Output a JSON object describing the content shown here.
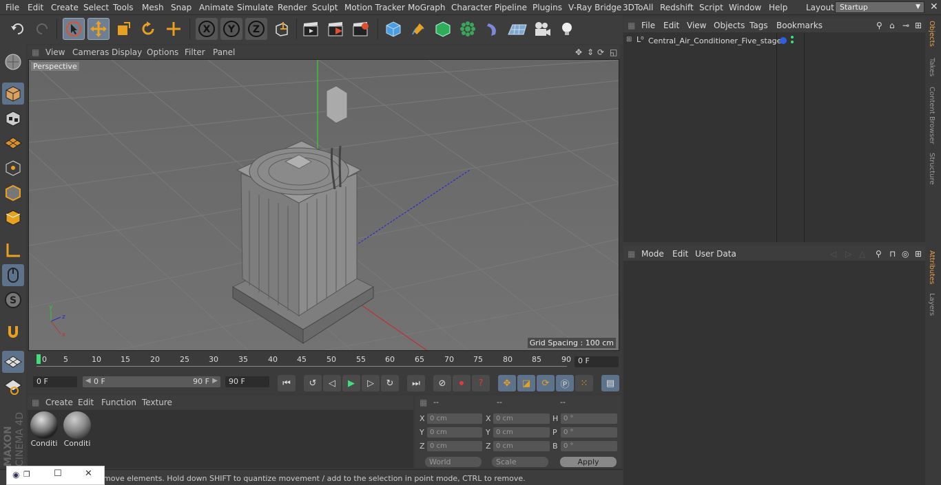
{
  "menubar": {
    "items": [
      "File",
      "Edit",
      "Create",
      "Select",
      "Tools",
      "Mesh",
      "Snap",
      "Animate",
      "Simulate",
      "Render",
      "Sculpt",
      "Motion Tracker",
      "MoGraph",
      "Character",
      "Pipeline",
      "Plugins",
      "V-Ray Bridge",
      "3DToAll",
      "Redshift",
      "Script",
      "Window",
      "Help"
    ],
    "layout_label": "Layout:",
    "layout_value": "Startup"
  },
  "viewport": {
    "menu": [
      "View",
      "Cameras",
      "Display",
      "Options",
      "Filter",
      "Panel"
    ],
    "label": "Perspective",
    "grid_spacing": "Grid Spacing : 100 cm"
  },
  "timeline": {
    "ticks": [
      "0",
      "5",
      "10",
      "15",
      "20",
      "25",
      "30",
      "35",
      "40",
      "45",
      "50",
      "55",
      "60",
      "65",
      "70",
      "75",
      "80",
      "85",
      "90"
    ],
    "current_frame": "0 F"
  },
  "transport": {
    "start": "0 F",
    "range_start": "0 F",
    "range_end": "90 F",
    "end": "90 F"
  },
  "materials": {
    "menu": [
      "Create",
      "Edit",
      "Function",
      "Texture"
    ],
    "items": [
      "Conditi",
      "Conditi"
    ]
  },
  "coords": {
    "headers": [
      "--",
      "--",
      "--"
    ],
    "rows": [
      {
        "a": "X",
        "av": "0 cm",
        "b": "X",
        "bv": "0 cm",
        "c": "H",
        "cv": "0 °"
      },
      {
        "a": "Y",
        "av": "0 cm",
        "b": "Y",
        "bv": "0 cm",
        "c": "P",
        "cv": "0 °"
      },
      {
        "a": "Z",
        "av": "0 cm",
        "b": "Z",
        "bv": "0 cm",
        "c": "B",
        "cv": "0 °"
      }
    ],
    "mode": "World",
    "scale": "Scale",
    "apply": "Apply"
  },
  "objects": {
    "menu": [
      "File",
      "Edit",
      "View",
      "Objects",
      "Tags",
      "Bookmarks"
    ],
    "item": "Central_Air_Conditioner_Five_stage"
  },
  "attributes": {
    "menu": [
      "Mode",
      "Edit",
      "User Data"
    ]
  },
  "sidetabs": [
    "Objects",
    "Takes",
    "Content Browser",
    "Structure",
    "Attributes",
    "Layers"
  ],
  "status": "move elements. Hold down SHIFT to quantize movement / add to the selection in point mode, CTRL to remove.",
  "brand": {
    "maxon": "MAXON",
    "product": "CINEMA 4D"
  }
}
